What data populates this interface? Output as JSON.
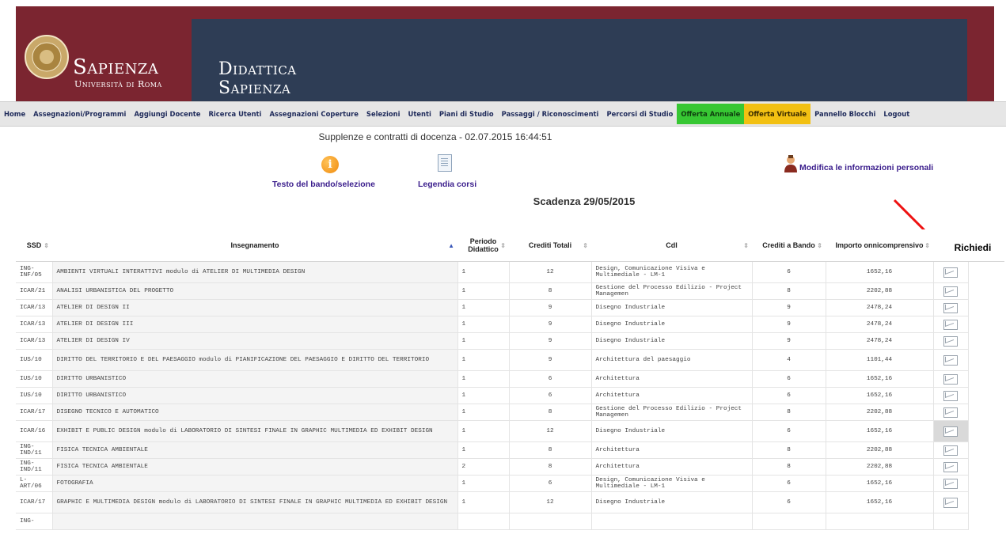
{
  "header": {
    "brand_name": "Sapienza",
    "brand_sub": "Università di Roma",
    "section_line1": "Didattica",
    "section_line2": "Sapienza"
  },
  "nav": {
    "items": [
      {
        "label": "Home"
      },
      {
        "label": "Assegnazioni/Programmi"
      },
      {
        "label": "Aggiungi Docente"
      },
      {
        "label": "Ricerca Utenti"
      },
      {
        "label": "Assegnazioni Coperture"
      },
      {
        "label": "Selezioni"
      },
      {
        "label": "Utenti"
      },
      {
        "label": "Piani di Studio"
      },
      {
        "label": "Passaggi / Riconoscimenti"
      },
      {
        "label": "Percorsi di Studio"
      },
      {
        "label": "Offerta Annuale",
        "color": "#37c733"
      },
      {
        "label": "Offerta Virtuale",
        "color": "#f2c012"
      },
      {
        "label": "Pannello Blocchi"
      },
      {
        "label": "Logout"
      }
    ]
  },
  "page": {
    "title": "Supplenze e contratti di docenza - 02.07.2015 16:44:51",
    "bando_link": "Testo del bando/selezione",
    "legenda_link": "Legendia corsi",
    "profile_link": "Modifica le informazioni personali",
    "deadline": "Scadenza 29/05/2015"
  },
  "table": {
    "headers": {
      "ssd": "SSD",
      "insegnamento": "Insegnamento",
      "periodo": "Periodo Didattico",
      "crediti_tot": "Crediti Totali",
      "cdl": "CdI",
      "crediti_bando": "Crediti a Bando",
      "importo": "Importo onnicomprensivo",
      "richiedi": "Richiedi"
    },
    "rows": [
      {
        "ssd": "ING-INF/05",
        "ins": "AMBIENTI VIRTUALI INTERATTIVI modulo di ATELIER DI MULTIMEDIA DESIGN",
        "per": "1",
        "ct": "12",
        "cdl": "Design, Comunicazione Visiva e Multimediale - LM-1",
        "cb": "6",
        "imp": "1652,16"
      },
      {
        "ssd": "ICAR/21",
        "ins": "ANALISI URBANISTICA DEL PROGETTO",
        "per": "1",
        "ct": "8",
        "cdl": "Gestione del Processo Edilizio - Project Managemen",
        "cb": "8",
        "imp": "2202,88"
      },
      {
        "ssd": "ICAR/13",
        "ins": "ATELIER DI DESIGN II",
        "per": "1",
        "ct": "9",
        "cdl": "Disegno Industriale",
        "cb": "9",
        "imp": "2478,24"
      },
      {
        "ssd": "ICAR/13",
        "ins": "ATELIER DI DESIGN III",
        "per": "1",
        "ct": "9",
        "cdl": "Disegno Industriale",
        "cb": "9",
        "imp": "2478,24"
      },
      {
        "ssd": "ICAR/13",
        "ins": "ATELIER DI DESIGN IV",
        "per": "1",
        "ct": "9",
        "cdl": "Disegno Industriale",
        "cb": "9",
        "imp": "2478,24"
      },
      {
        "ssd": "IUS/10",
        "ins": "DIRITTO DEL TERRITORIO E DEL PAESAGGIO modulo di PIANIFICAZIONE DEL PAESAGGIO E DIRITTO DEL TERRITORIO",
        "per": "1",
        "ct": "9",
        "cdl": "Architettura del paesaggio",
        "cb": "4",
        "imp": "1101,44"
      },
      {
        "ssd": "IUS/10",
        "ins": "DIRITTO URBANISTICO",
        "per": "1",
        "ct": "6",
        "cdl": "Architettura",
        "cb": "6",
        "imp": "1652,16"
      },
      {
        "ssd": "IUS/10",
        "ins": "DIRITTO URBANISTICO",
        "per": "1",
        "ct": "6",
        "cdl": "Architettura",
        "cb": "6",
        "imp": "1652,16"
      },
      {
        "ssd": "ICAR/17",
        "ins": "DISEGNO TECNICO E AUTOMATICO",
        "per": "1",
        "ct": "8",
        "cdl": "Gestione del Processo Edilizio - Project Managemen",
        "cb": "8",
        "imp": "2202,88"
      },
      {
        "ssd": "ICAR/16",
        "ins": "EXHIBIT E PUBLIC DESIGN modulo di LABORATORIO DI SINTESI FINALE IN GRAPHIC MULTIMEDIA ED EXHIBIT DESIGN",
        "per": "1",
        "ct": "12",
        "cdl": "Disegno Industriale",
        "cb": "6",
        "imp": "1652,16"
      },
      {
        "ssd": "ING-IND/11",
        "ins": "FISICA TECNICA AMBIENTALE",
        "per": "1",
        "ct": "8",
        "cdl": "Architettura",
        "cb": "8",
        "imp": "2202,88"
      },
      {
        "ssd": "ING-IND/11",
        "ins": "FISICA TECNICA AMBIENTALE",
        "per": "2",
        "ct": "8",
        "cdl": "Architettura",
        "cb": "8",
        "imp": "2202,88"
      },
      {
        "ssd": "L-ART/06",
        "ins": "FOTOGRAFIA",
        "per": "1",
        "ct": "6",
        "cdl": "Design, Comunicazione Visiva e Multimediale - LM-1",
        "cb": "6",
        "imp": "1652,16"
      },
      {
        "ssd": "ICAR/17",
        "ins": "GRAPHIC E MULTIMEDIA DESIGN modulo di LABORATORIO DI SINTESI FINALE IN GRAPHIC MULTIMEDIA ED EXHIBIT DESIGN",
        "per": "1",
        "ct": "12",
        "cdl": "Disegno Industriale",
        "cb": "6",
        "imp": "1652,16"
      },
      {
        "ssd": "ING-",
        "ins": "",
        "per": "",
        "ct": "",
        "cdl": "",
        "cb": "",
        "imp": ""
      }
    ]
  }
}
